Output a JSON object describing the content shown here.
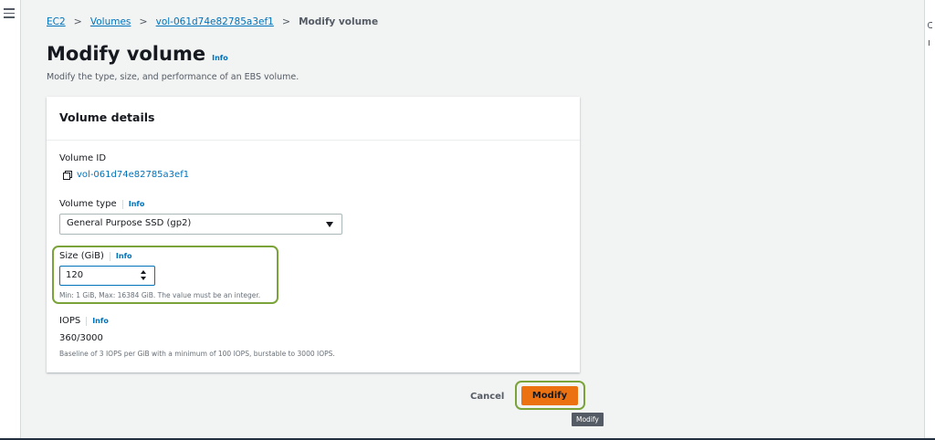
{
  "breadcrumb": {
    "items": [
      "EC2",
      "Volumes",
      "vol-061d74e82785a3ef1"
    ],
    "current": "Modify volume",
    "separator": ">"
  },
  "page": {
    "title": "Modify volume",
    "info_label": "Info",
    "description": "Modify the type, size, and performance of an EBS volume."
  },
  "panel": {
    "header": "Volume details",
    "volume_id": {
      "label": "Volume ID",
      "value": "vol-061d74e82785a3ef1",
      "icon": "copy-icon"
    },
    "volume_type": {
      "label": "Volume type",
      "info": "Info",
      "selected": "General Purpose SSD (gp2)"
    },
    "size": {
      "label": "Size (GiB)",
      "info": "Info",
      "value": "120",
      "constraint": "Min: 1 GiB, Max: 16384 GiB. The value must be an integer."
    },
    "iops": {
      "label": "IOPS",
      "info": "Info",
      "value": "360/3000",
      "description": "Baseline of 3 IOPS per GiB with a minimum of 100 IOPS, burstable to 3000 IOPS."
    }
  },
  "actions": {
    "cancel": "Cancel",
    "modify": "Modify",
    "tooltip": "Modify"
  },
  "colors": {
    "link": "#0073bb",
    "primary_button": "#ec7211",
    "highlight": "#7aa33a"
  }
}
